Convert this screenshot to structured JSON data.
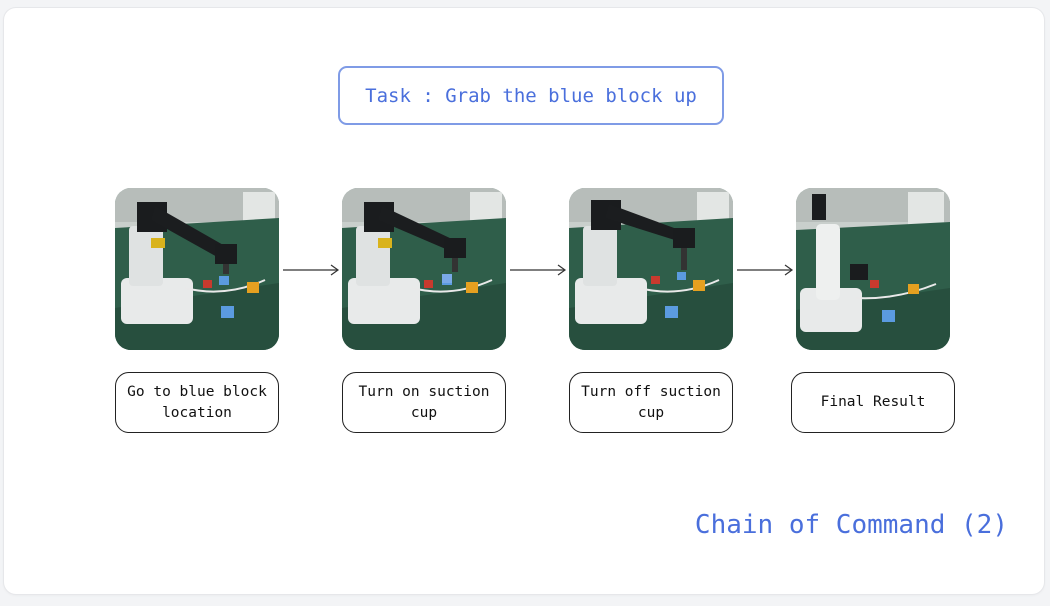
{
  "task": {
    "text": "Task : Grab the blue block up"
  },
  "steps": [
    {
      "label": "Go to blue block location",
      "photo": "robot-arm-photo"
    },
    {
      "label": "Turn on suction cup",
      "photo": "robot-arm-photo"
    },
    {
      "label": "Turn off suction cup",
      "photo": "robot-arm-photo"
    },
    {
      "label": "Final Result",
      "photo": "robot-arm-photo"
    }
  ],
  "footer": {
    "title": "Chain of Command (2)"
  },
  "colors": {
    "accent": "#4a6fdc",
    "task_border": "#7f9be6",
    "table_green": "#2e5a48",
    "block_blue": "#5b9be0",
    "block_red": "#c83a2e",
    "block_orange": "#e5a020"
  }
}
